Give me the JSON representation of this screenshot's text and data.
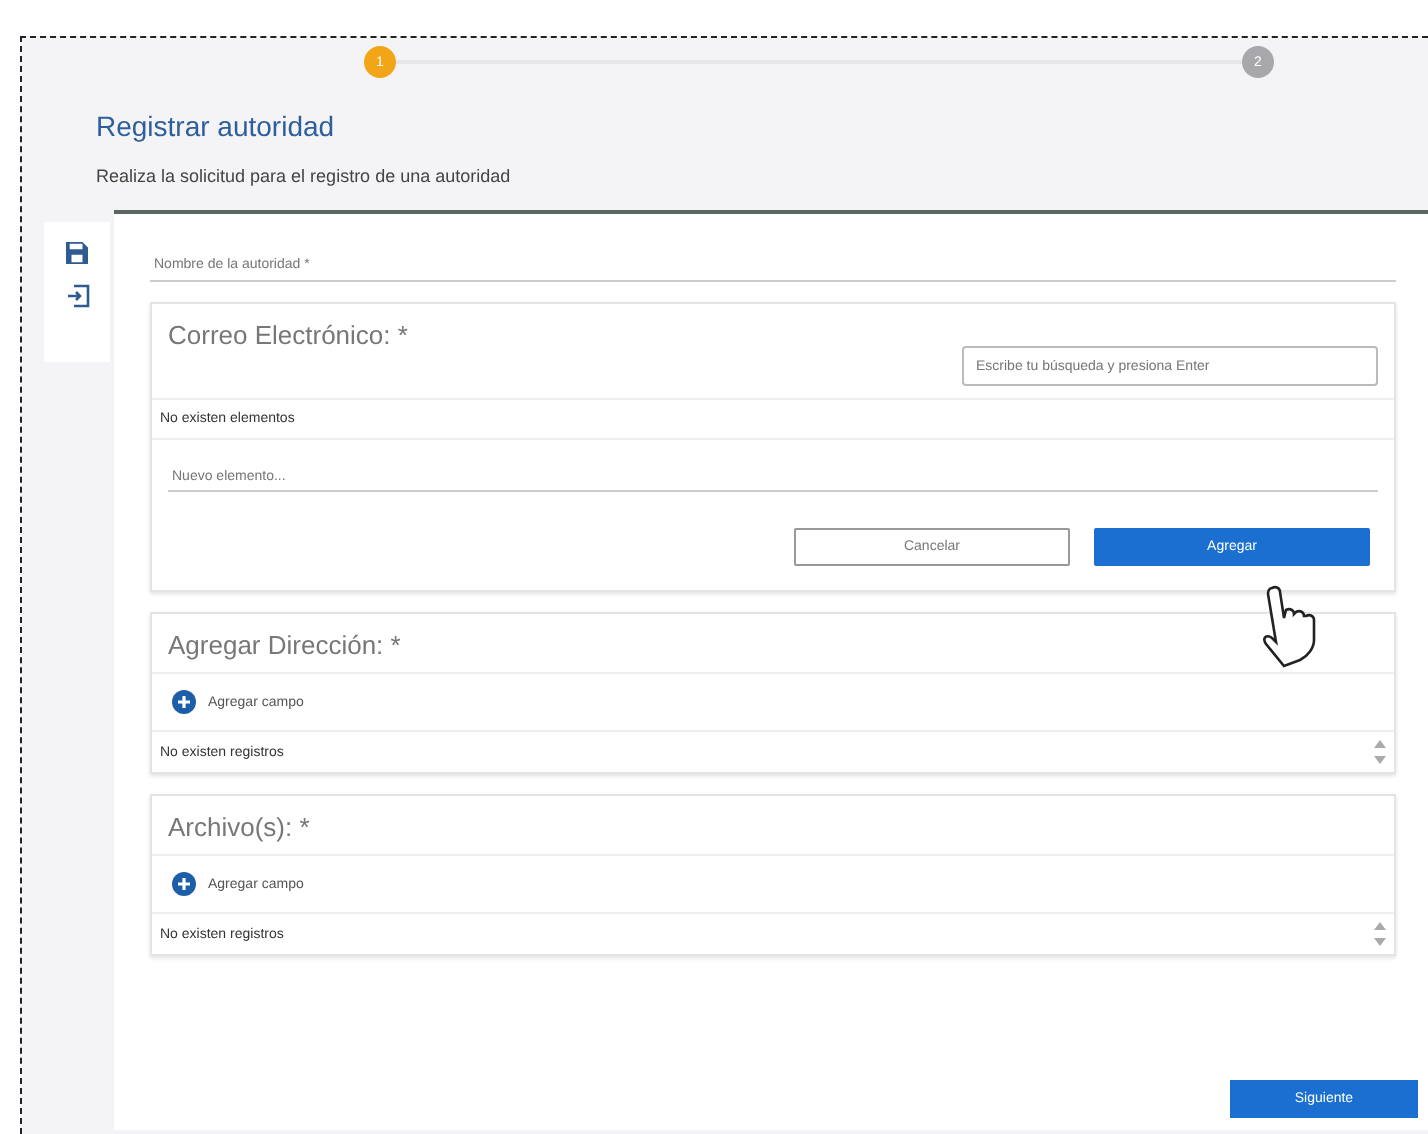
{
  "stepper": {
    "steps": [
      {
        "label": "1",
        "selected": true
      },
      {
        "label": "2",
        "selected": false
      }
    ]
  },
  "header": {
    "title": "Registrar autoridad",
    "subtitle": "Realiza la solicitud para el registro de una autoridad"
  },
  "name_field": {
    "placeholder": "Nombre de la autoridad *"
  },
  "sections": [
    {
      "kind": "email",
      "title": "Correo Electrónico: *",
      "search_placeholder": "Escribe tu búsqueda y presiona Enter",
      "empty_text": "No existen elementos",
      "new_placeholder": "Nuevo elemento...",
      "buttons": [
        "Cancelar",
        "Agregar"
      ]
    },
    {
      "kind": "list",
      "title": "Agregar Dirección: *",
      "add_label": "Agregar campo",
      "empty_text": "No existen registros"
    },
    {
      "kind": "list",
      "title": "Archivo(s): *",
      "add_label": "Agregar campo",
      "empty_text": "No existen registros"
    }
  ],
  "next_button": "Siguiente"
}
